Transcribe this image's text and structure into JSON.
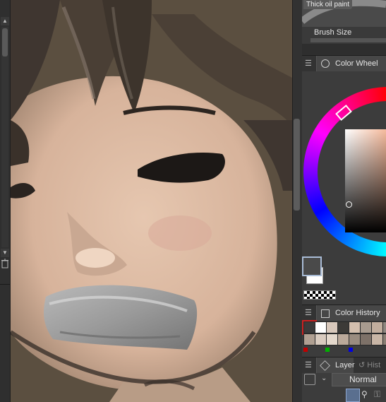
{
  "brush": {
    "name": "Thick oil paint",
    "size_label": "Brush Size"
  },
  "panels": {
    "color_wheel": {
      "tab_label": "Color Wheel"
    },
    "color_history": {
      "tab_label": "Color History"
    },
    "layer": {
      "tab_label": "Layer",
      "second_tab_label": "Hist",
      "blend_mode": "Normal"
    }
  },
  "colors": {
    "main_color": "#4a4a4a",
    "sub_color": "#ffffff",
    "history": [
      "#3a3a3a",
      "#ffffff",
      "#d8c8bb",
      "#3c3a37",
      "#d4bfae",
      "#a89b8f",
      "#c2ae9e",
      "#8f8780",
      "#b0a092",
      "#d9cbbf",
      "#e4d8cc",
      "#bba99a",
      "#9a8c80",
      "#7d7168",
      "#c9b6a6",
      "#8a7e73"
    ]
  }
}
